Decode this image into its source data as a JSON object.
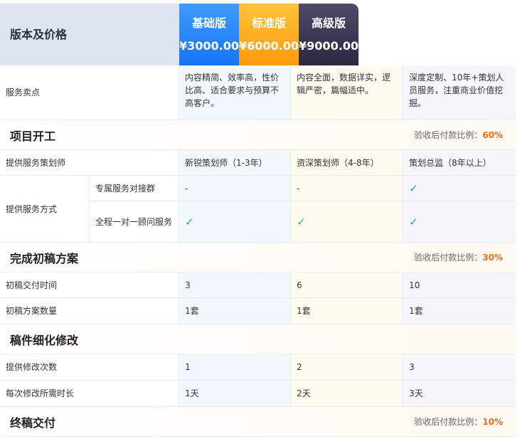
{
  "header": {
    "label": "版本及价格",
    "plans": [
      {
        "name": "基础版",
        "price": "¥3000.00"
      },
      {
        "name": "标准版",
        "price": "¥6000.00"
      },
      {
        "name": "高级版",
        "price": "¥9000.00"
      }
    ]
  },
  "selling": {
    "label": "服务卖点",
    "values": [
      "内容精简、效率高，性价比高、适合要求与预算不高客户。",
      "内容全面，数据详实，逻辑严密，篇幅适中。",
      "深度定制、10年+策划人员服务，注重商业价值挖掘。"
    ]
  },
  "sections": [
    {
      "title": "项目开工",
      "ratio_label": "验收后付款比例：",
      "ratio": "60%"
    },
    {
      "title": "完成初稿方案",
      "ratio_label": "验收后付款比例：",
      "ratio": "30%"
    },
    {
      "title": "稿件细化修改"
    },
    {
      "title": "终稿交付",
      "ratio_label": "验收后付款比例：",
      "ratio": "10%"
    }
  ],
  "planner": {
    "label": "提供服务策划师",
    "values": [
      "新锐策划师（1-3年）",
      "资深策划师（4-8年）",
      "策划总监（8年以上）"
    ]
  },
  "service_mode": {
    "label": "提供服务方式",
    "rows": [
      {
        "label": "专属服务对接群",
        "values": [
          "-",
          "-",
          "✓"
        ]
      },
      {
        "label": "全程一对一顾问服务",
        "values": [
          "✓",
          "✓",
          "✓"
        ]
      }
    ]
  },
  "draft_time": {
    "label": "初稿交付时间",
    "values": [
      "3",
      "6",
      "10"
    ]
  },
  "draft_count": {
    "label": "初稿方案数量",
    "values": [
      "1套",
      "1套",
      "1套"
    ]
  },
  "revisions": {
    "label": "提供修改次数",
    "values": [
      "1",
      "2",
      "3"
    ]
  },
  "revision_time": {
    "label": "每次修改所需时长",
    "values": [
      "1天",
      "2天",
      "3天"
    ]
  },
  "colors": {
    "accent_basic": "#1574f5",
    "accent_std": "#ff9a0c",
    "accent_adv": "#2b2940",
    "ratio": "#f26b1d",
    "check": "#2bb07a"
  }
}
